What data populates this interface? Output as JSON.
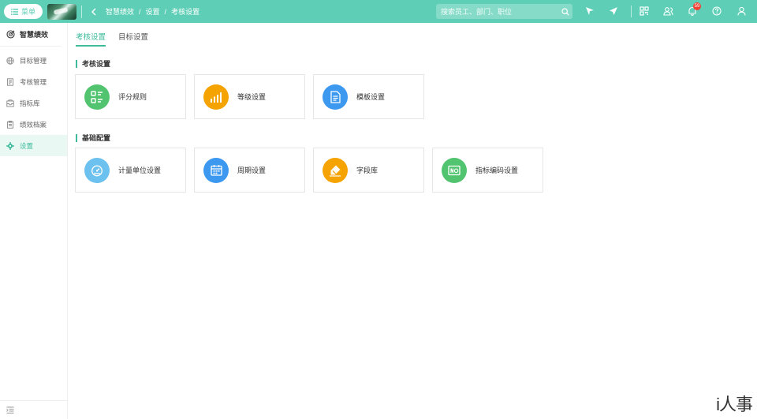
{
  "topbar": {
    "menu_label": "菜单",
    "breadcrumb": [
      "智慧绩效",
      "设置",
      "考核设置"
    ],
    "breadcrumb_sep": "/",
    "search_placeholder": "搜索员工、部门、职位",
    "notification_count": "59",
    "icons": [
      "send-outline-icon",
      "paper-plane-icon",
      "qrcode-icon",
      "contacts-icon",
      "bell-icon",
      "help-icon",
      "user-icon"
    ]
  },
  "sidebar": {
    "title": "智慧绩效",
    "items": [
      {
        "label": "目标管理",
        "icon": "globe-icon"
      },
      {
        "label": "考核管理",
        "icon": "document-icon"
      },
      {
        "label": "指标库",
        "icon": "inbox-icon"
      },
      {
        "label": "绩效档案",
        "icon": "clipboard-icon"
      },
      {
        "label": "设置",
        "icon": "gear-icon",
        "active": true
      }
    ]
  },
  "tabs": [
    {
      "label": "考核设置",
      "active": true
    },
    {
      "label": "目标设置",
      "active": false
    }
  ],
  "sections": [
    {
      "title": "考核设置",
      "cards": [
        {
          "label": "评分规则",
          "icon": "list-grid-icon",
          "color": "#52c46f"
        },
        {
          "label": "等级设置",
          "icon": "bar-chart-icon",
          "color": "#f5a300"
        },
        {
          "label": "模板设置",
          "icon": "file-text-icon",
          "color": "#3d98f0"
        }
      ]
    },
    {
      "title": "基础配置",
      "cards": [
        {
          "label": "计量单位设置",
          "icon": "dashboard-gauge-icon",
          "color": "#6cc1ee"
        },
        {
          "label": "周期设置",
          "icon": "calendar-icon",
          "color": "#3d98f0"
        },
        {
          "label": "字段库",
          "icon": "eraser-icon",
          "color": "#f5a300"
        },
        {
          "label": "指标编码设置",
          "icon": "code-badge-icon",
          "color": "#52c46f"
        }
      ]
    }
  ],
  "watermark": "i人事",
  "colors": {
    "primary": "#5ecfb6",
    "accent": "#3dbb9b"
  }
}
